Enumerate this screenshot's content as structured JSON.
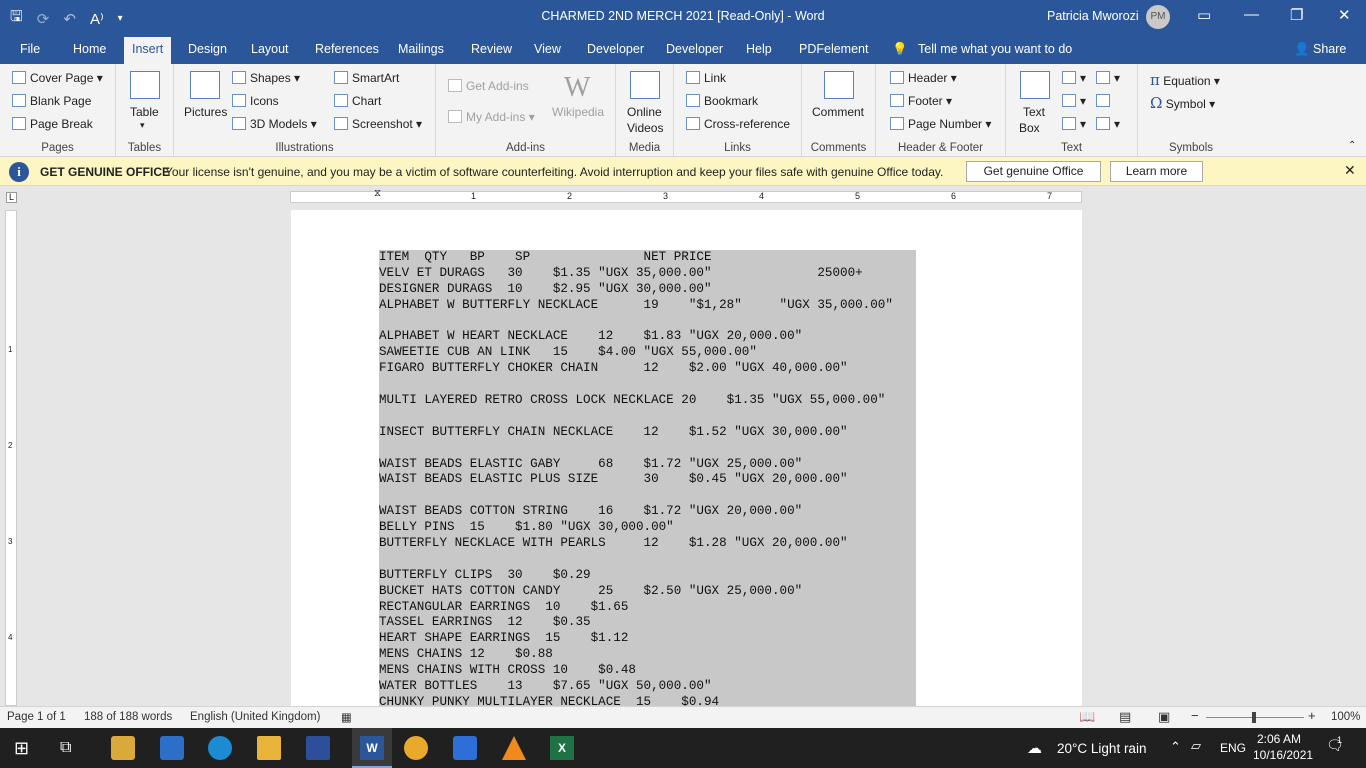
{
  "window": {
    "title": "CHARMED 2ND MERCH 2021 [Read-Only]  -  Word",
    "user": "Patricia Mworozi",
    "user_initials": "PM"
  },
  "menu": [
    "File",
    "Home",
    "Insert",
    "Design",
    "Layout",
    "References",
    "Mailings",
    "Review",
    "View",
    "Developer",
    "Developer",
    "Help",
    "PDFelement"
  ],
  "tell_me": "Tell me what you want to do",
  "share": "Share",
  "ribbon": {
    "pages": {
      "label": "Pages",
      "items": [
        "Cover Page",
        "Blank Page",
        "Page Break"
      ]
    },
    "tables": {
      "label": "Tables",
      "table": "Table"
    },
    "illustrations": {
      "label": "Illustrations",
      "pictures": "Pictures",
      "shapes": "Shapes",
      "icons": "Icons",
      "models": "3D Models",
      "smartart": "SmartArt",
      "chart": "Chart",
      "screenshot": "Screenshot"
    },
    "addins": {
      "label": "Add-ins",
      "get": "Get Add-ins",
      "my": "My Add-ins",
      "wikipedia": "Wikipedia"
    },
    "media": {
      "label": "Media",
      "online_videos_1": "Online",
      "online_videos_2": "Videos"
    },
    "links": {
      "label": "Links",
      "link": "Link",
      "bookmark": "Bookmark",
      "crossref": "Cross-reference"
    },
    "comments": {
      "label": "Comments",
      "comment": "Comment"
    },
    "hf": {
      "label": "Header & Footer",
      "header": "Header",
      "footer": "Footer",
      "page_number": "Page Number"
    },
    "text": {
      "label": "Text",
      "textbox_1": "Text",
      "textbox_2": "Box"
    },
    "symbols": {
      "label": "Symbols",
      "equation": "Equation",
      "symbol": "Symbol"
    }
  },
  "notice": {
    "title": "GET GENUINE OFFICE",
    "message": "Your license isn't genuine, and you may be a victim of software counterfeiting. Avoid interruption and keep your files safe with genuine Office today.",
    "button1": "Get genuine Office",
    "button2": "Learn more"
  },
  "ruler_numbers": [
    "1",
    "2",
    "3",
    "4",
    "5",
    "6",
    "7"
  ],
  "document_lines": [
    "ITEM  QTY   BP    SP               NET PRICE  ",
    "VELV ET DURAGS   30    $1.35 \"UGX 35,000.00\"              25000+ ",
    "DESIGNER DURAGS  10    $2.95 \"UGX 30,000.00\"               ",
    "ALPHABET W BUTTERFLY NECKLACE      19    \"$1,28\"     \"UGX 35,000.00\" ",
    "        ",
    "ALPHABET W HEART NECKLACE    12    $1.83 \"UGX 20,000.00\"               ",
    "SAWEETIE CUB AN LINK   15    $4.00 \"UGX 55,000.00\"     ",
    "FIGARO BUTTERFLY CHOKER CHAIN      12    $2.00 \"UGX 40,000.00\"        ",
    "    ",
    "MULTI LAYERED RETRO CROSS LOCK NECKLACE 20    $1.35 \"UGX 55,000.00\"  ",
    "        ",
    "INSECT BUTTERFLY CHAIN NECKLACE    12    $1.52 \"UGX 30,000.00\"        ",
    "    ",
    "WAIST BEADS ELASTIC GABY     68    $1.72 \"UGX 25,000.00\"               ",
    "WAIST BEADS ELASTIC PLUS SIZE      30    $0.45 \"UGX 20,000.00\"        ",
    "    ",
    "WAIST BEADS COTTON STRING    16    $1.72 \"UGX 20,000.00\"               ",
    "BELLY PINS  15    $1.80 \"UGX 30,000.00\"                ",
    "BUTTERFLY NECKLACE WITH PEARLS     12    $1.28 \"UGX 20,000.00\"        ",
    "    ",
    "BUTTERFLY CLIPS  30    $0.29                   ",
    "BUCKET HATS COTTON CANDY     25    $2.50 \"UGX 25,000.00\"               ",
    "RECTANGULAR EARRINGS  10    $1.65                     ",
    "TASSEL EARRINGS  12    $0.35                   ",
    "HEART SHAPE EARRINGS  15    $1.12                     ",
    "MENS CHAINS 12    $0.88                   ",
    "MENS CHAINS WITH CROSS 10    $0.48                      ",
    "WATER BOTTLES    13    $7.65 \"UGX 50,000.00\"               ",
    "CHUNKY PUNKY MULTILAYER NECKLACE  15    $0.94                  "
  ],
  "status": {
    "page": "Page 1 of 1",
    "words": "188 of 188 words",
    "language": "English (United Kingdom)",
    "zoom": "100%"
  },
  "taskbar": {
    "weather": "20°C  Light rain",
    "lang": "ENG",
    "time": "2:06 AM",
    "date": "10/16/2021",
    "notifications": "1"
  },
  "colors": {
    "word_blue": "#2b579a",
    "notice_bg": "#fdf6c3",
    "highlight": "#c8c8c8"
  }
}
